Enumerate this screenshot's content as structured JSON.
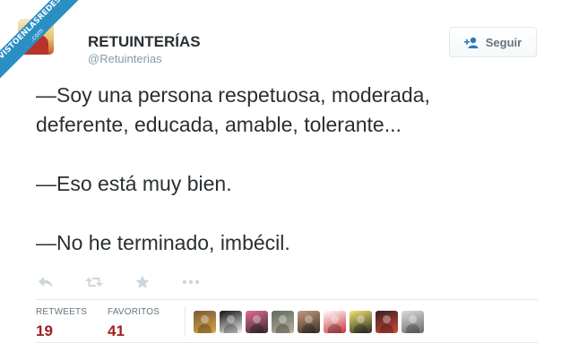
{
  "watermark": {
    "brand": "VISTOENLASREDES",
    "suffix": ".com"
  },
  "account": {
    "name": "RETUINTERÍAS",
    "handle": "@Retuinterias",
    "avatar_icon": "king-avatar"
  },
  "follow_button": {
    "label": "Seguir",
    "icon": "add-user-icon"
  },
  "tweet": {
    "lines": [
      "—Soy una persona respetuosa, moderada,",
      "deferente, educada, amable, tolerante...",
      "—Eso está muy bien.",
      "—No he terminado, imbécil."
    ]
  },
  "actions": [
    "reply-icon",
    "retweet-icon",
    "favorite-icon",
    "more-icon"
  ],
  "stats": {
    "retweets_label": "RETWEETS",
    "retweets_value": "19",
    "favorites_label": "FAVORITOS",
    "favorites_value": "41"
  },
  "favoriters": [
    {
      "icon": "avatar-1",
      "colors": [
        "#7a5b3a",
        "#d9a441"
      ]
    },
    {
      "icon": "avatar-2",
      "colors": [
        "#111111",
        "#f2f2f2"
      ]
    },
    {
      "icon": "avatar-3",
      "colors": [
        "#e06a9a",
        "#3a2a2a"
      ]
    },
    {
      "icon": "avatar-4",
      "colors": [
        "#5f6b5a",
        "#b9b1a0"
      ]
    },
    {
      "icon": "avatar-5",
      "colors": [
        "#c49a7a",
        "#3b2f2a"
      ]
    },
    {
      "icon": "avatar-6",
      "colors": [
        "#ffffff",
        "#c8323a"
      ]
    },
    {
      "icon": "avatar-7",
      "colors": [
        "#f4e36a",
        "#2a2a2a"
      ]
    },
    {
      "icon": "avatar-8",
      "colors": [
        "#3a1f1f",
        "#d14a3a"
      ]
    },
    {
      "icon": "avatar-9",
      "colors": [
        "#dcdcdc",
        "#6a6a6a"
      ]
    }
  ],
  "colors": {
    "accent_value": "#a41e1e",
    "muted": "#8899a6",
    "ribbon": "#2b8fc4"
  }
}
